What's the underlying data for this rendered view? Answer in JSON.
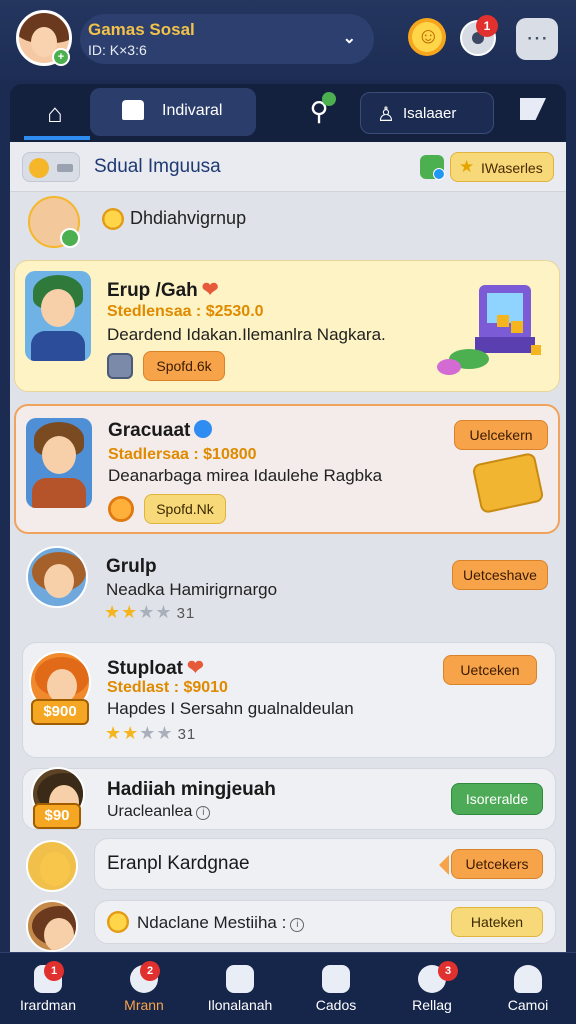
{
  "header": {
    "name": "Gamas Sosal",
    "id": "ID: K×3:6",
    "chevron": "⌄"
  },
  "tabs": {
    "individual": "Indivaral",
    "friends": "Isalaaer"
  },
  "section": {
    "title": "Sdual Imguusa",
    "prize_button": "IWaserles"
  },
  "intro": {
    "text": "Dhdiahvigrnup"
  },
  "cards": [
    {
      "title": "Erup /Gah",
      "stat": "Stedlensaa : $2530.0",
      "desc": "Deardend Idakan.Ilemanlra Nagkara.",
      "button": "Spofd.6k"
    },
    {
      "title": "Gracuaat",
      "stat": "Stadlersaa : $10800",
      "desc": "Deanarbaga mirea Idaulehe Ragbka",
      "button": "Spofd.Nk",
      "action": "Uelcekern"
    },
    {
      "title": "Grulp",
      "desc": "Neadka Hamirigrnargo",
      "rating": "31",
      "action": "Uetceshave"
    },
    {
      "title": "Stuploat",
      "stat": "Stedlast : $9010",
      "desc": "Hapdes I Sersahn gualnaldeulan",
      "rating": "31",
      "action": "Uetceken",
      "badge": "$900"
    },
    {
      "title": "Hadiiah mingjeuah",
      "desc": "Uracleanlea",
      "action": "Isoreralde",
      "badge": "$90"
    },
    {
      "title": "Eranpl Kardgnae",
      "action": "Uetcekers"
    },
    {
      "title": "Ndaclane Mestiiha :",
      "action": "Hateken"
    }
  ],
  "nav": [
    {
      "label": "Irardman",
      "badge": "1"
    },
    {
      "label": "Mrann",
      "badge": "2"
    },
    {
      "label": "Ilonalanah"
    },
    {
      "label": "Cados"
    },
    {
      "label": "Rellag",
      "badge": "3"
    },
    {
      "label": "Camoi"
    }
  ],
  "colors": {
    "accent_orange": "#f7a34a",
    "brand_navy": "#1b2b52",
    "gold": "#f5b51f",
    "green": "#4daa57"
  }
}
